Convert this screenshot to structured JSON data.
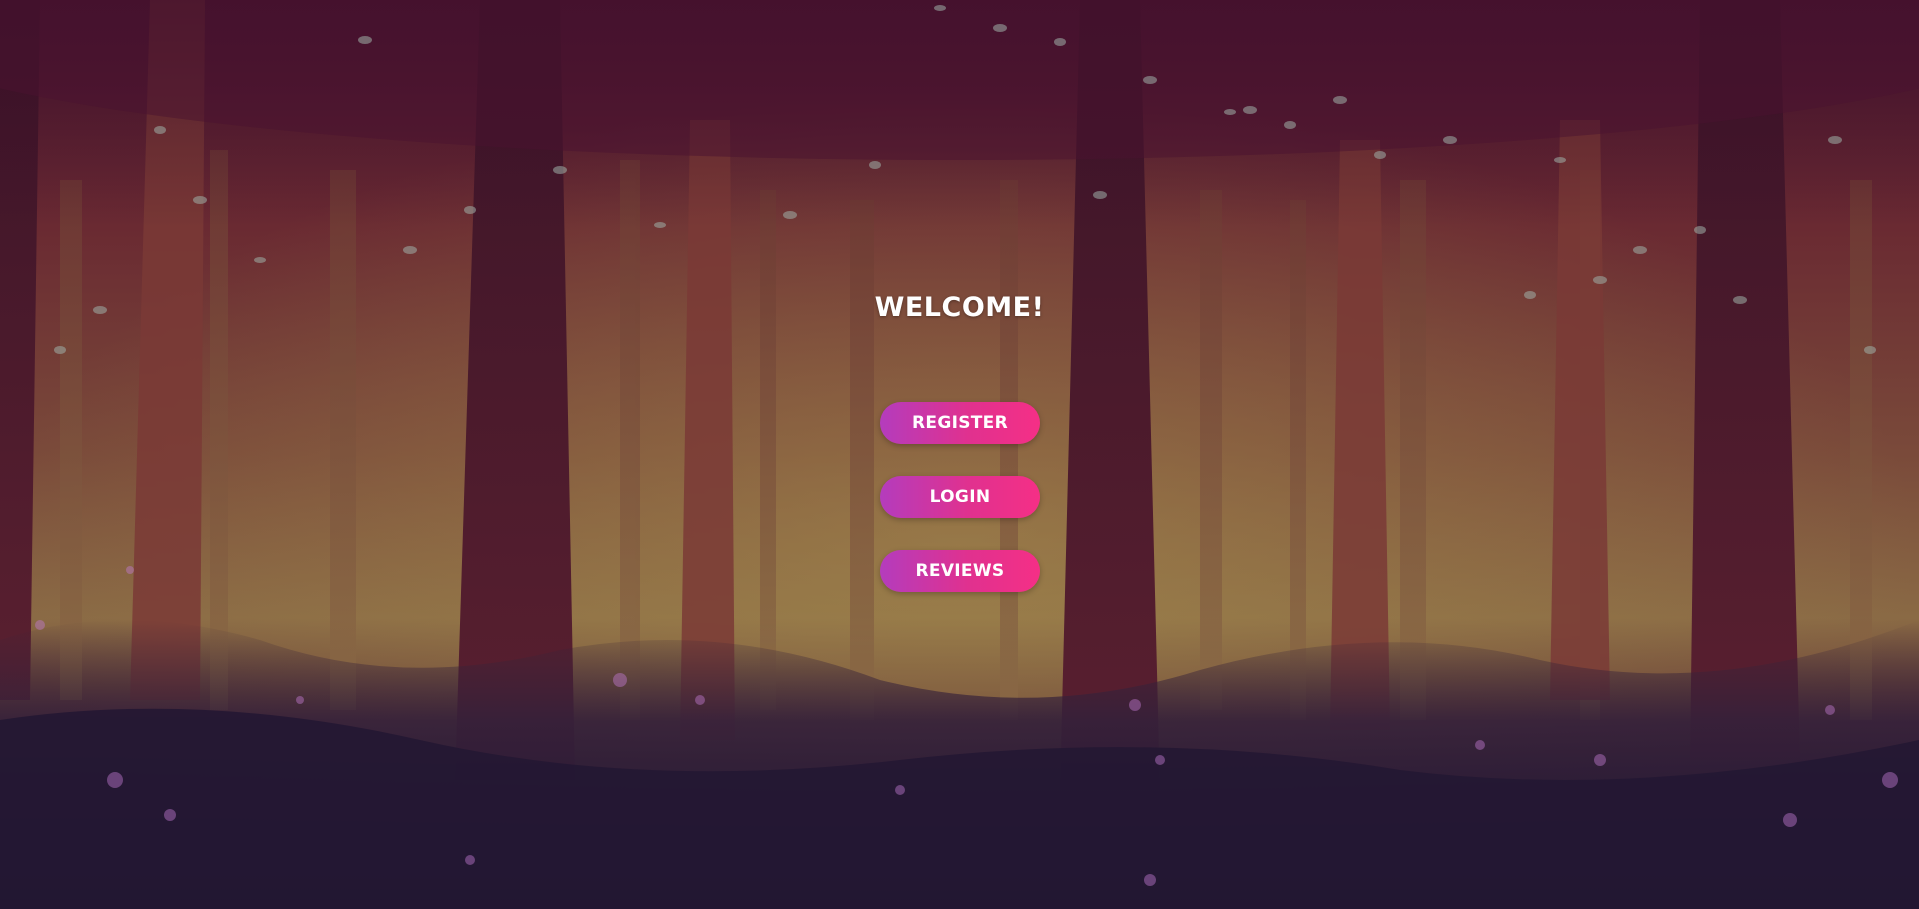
{
  "page": {
    "title": "WELCOME!"
  },
  "buttons": {
    "register_label": "REGISTER",
    "login_label": "LOGIN",
    "reviews_label": "REVIEWS"
  },
  "colors": {
    "button_gradient_start": "#b43cbd",
    "button_gradient_end": "#f52f86",
    "title_color": "#ffffff",
    "background_tint": "#5a1c3a"
  }
}
